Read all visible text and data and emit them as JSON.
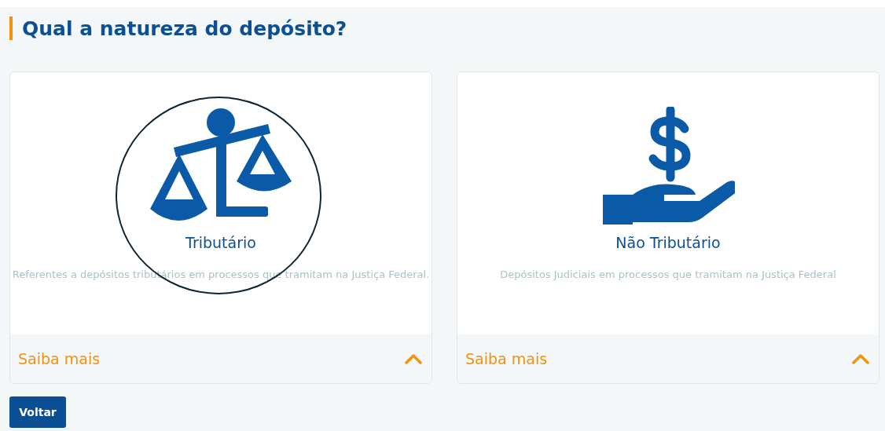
{
  "heading": "Qual a natureza do depósito?",
  "cards": [
    {
      "kind": "scale",
      "title": "Tributário",
      "description": "Referentes a depósitos tributários em processos que tramitam na Justiça Federal.",
      "more": "Saiba mais",
      "expanded": true,
      "highlighted": true
    },
    {
      "kind": "dollar",
      "title": "Não Tributário",
      "description": "Depósitos Judiciais em processos que tramitam na Justiça Federal",
      "more": "Saiba mais",
      "expanded": true,
      "highlighted": false
    }
  ],
  "back_button": "Voltar"
}
